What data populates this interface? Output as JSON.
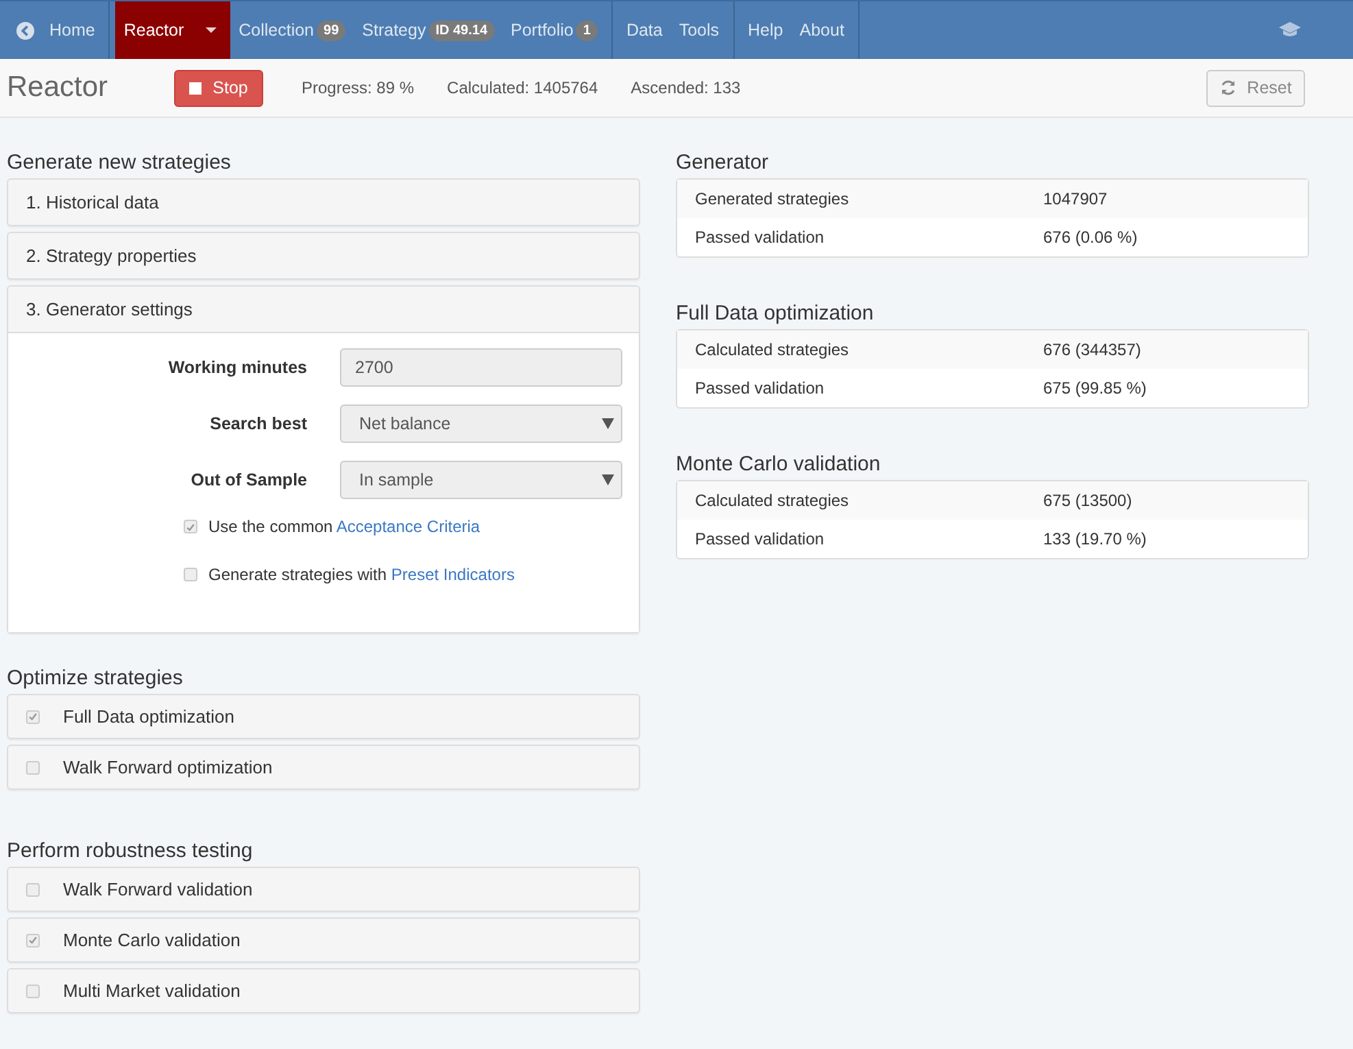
{
  "nav": {
    "groups": [
      [
        {
          "label": "Home",
          "kind": "back",
          "selected": false
        }
      ],
      [
        {
          "label": "Reactor",
          "kind": "dropdown",
          "selected": true
        },
        {
          "label": "Collection",
          "kind": "link",
          "badge": "99",
          "selected": false
        },
        {
          "label": "Strategy",
          "kind": "link",
          "badge": "ID 49.14",
          "selected": false
        },
        {
          "label": "Portfolio",
          "kind": "link",
          "badge": "1",
          "selected": false
        }
      ],
      [
        {
          "label": "Data",
          "kind": "link",
          "selected": false
        },
        {
          "label": "Tools",
          "kind": "link",
          "selected": false
        }
      ],
      [
        {
          "label": "Help",
          "kind": "link",
          "selected": false
        },
        {
          "label": "About",
          "kind": "link",
          "selected": false
        }
      ]
    ]
  },
  "header": {
    "title": "Reactor",
    "stop_button": "Stop",
    "stats": [
      "Progress: 89 %",
      "Calculated: 1405764",
      "Ascended: 133"
    ],
    "reset_button": "Reset"
  },
  "generate": {
    "title": "Generate new strategies",
    "panels": [
      {
        "label": "1. Historical data",
        "expanded": false
      },
      {
        "label": "2. Strategy properties",
        "expanded": false
      },
      {
        "label": "3. Generator settings",
        "expanded": true
      }
    ],
    "fields": [
      {
        "label": "Working minutes",
        "kind": "input",
        "value": "2700"
      },
      {
        "label": "Search best",
        "kind": "select",
        "value": "Net balance"
      },
      {
        "label": "Out of Sample",
        "kind": "select",
        "value": "In sample"
      }
    ],
    "options": [
      {
        "text": "Use the common ",
        "link": "Acceptance Criteria",
        "checked": true
      },
      {
        "text": "Generate strategies with ",
        "link": "Preset Indicators",
        "checked": false
      }
    ]
  },
  "optimize": {
    "title": "Optimize strategies",
    "items": [
      {
        "label": "Full Data optimization",
        "checked": true
      },
      {
        "label": "Walk Forward optimization",
        "checked": false
      }
    ]
  },
  "robustness": {
    "title": "Perform robustness testing",
    "items": [
      {
        "label": "Walk Forward validation",
        "checked": false
      },
      {
        "label": "Monte Carlo validation",
        "checked": true
      },
      {
        "label": "Multi Market validation",
        "checked": false
      }
    ]
  },
  "stats_tables": [
    {
      "title": "Generator",
      "rows": [
        {
          "label": "Generated strategies",
          "value": "1047907"
        },
        {
          "label": "Passed validation",
          "value": "676 (0.06 %)"
        }
      ]
    },
    {
      "title": "Full Data optimization",
      "rows": [
        {
          "label": "Calculated strategies",
          "value": "676 (344357)"
        },
        {
          "label": "Passed validation",
          "value": "675 (99.85 %)"
        }
      ]
    },
    {
      "title": "Monte Carlo validation",
      "rows": [
        {
          "label": "Calculated strategies",
          "value": "675 (13500)"
        },
        {
          "label": "Passed validation",
          "value": "133 (19.70 %)"
        }
      ]
    }
  ]
}
